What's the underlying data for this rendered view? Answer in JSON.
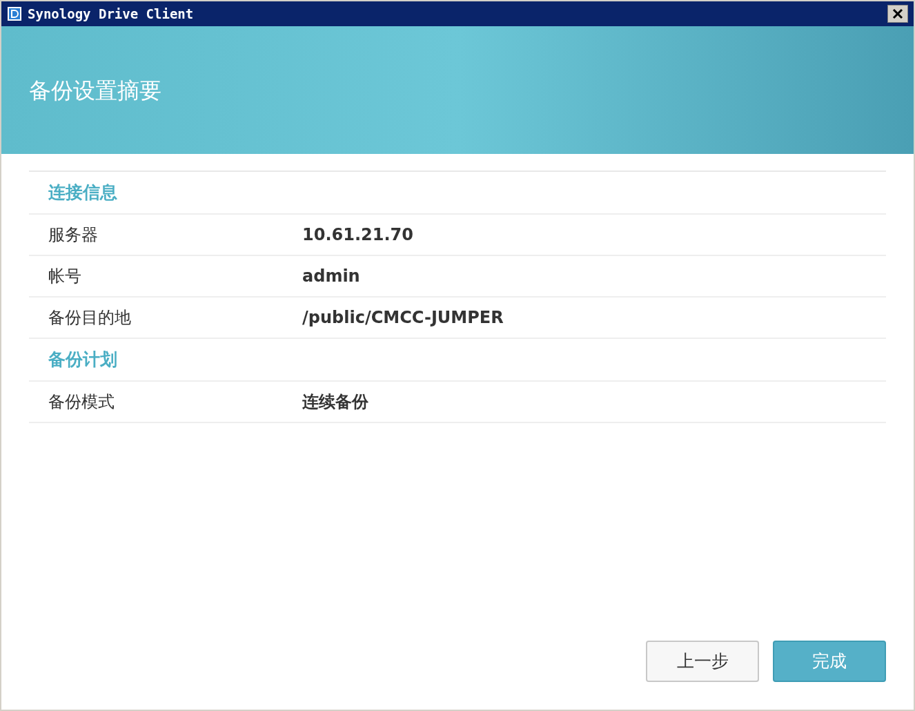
{
  "window": {
    "title": "Synology Drive Client"
  },
  "header": {
    "title": "备份设置摘要"
  },
  "sections": [
    {
      "title": "连接信息",
      "rows": [
        {
          "label": "服务器",
          "value": "10.61.21.70"
        },
        {
          "label": "帐号",
          "value": "admin"
        },
        {
          "label": "备份目的地",
          "value": "/public/CMCC-JUMPER"
        }
      ]
    },
    {
      "title": "备份计划",
      "rows": [
        {
          "label": "备份模式",
          "value": "连续备份"
        }
      ]
    }
  ],
  "buttons": [
    {
      "label": "上一步",
      "kind": "secondary"
    },
    {
      "label": "完成",
      "kind": "primary"
    }
  ]
}
